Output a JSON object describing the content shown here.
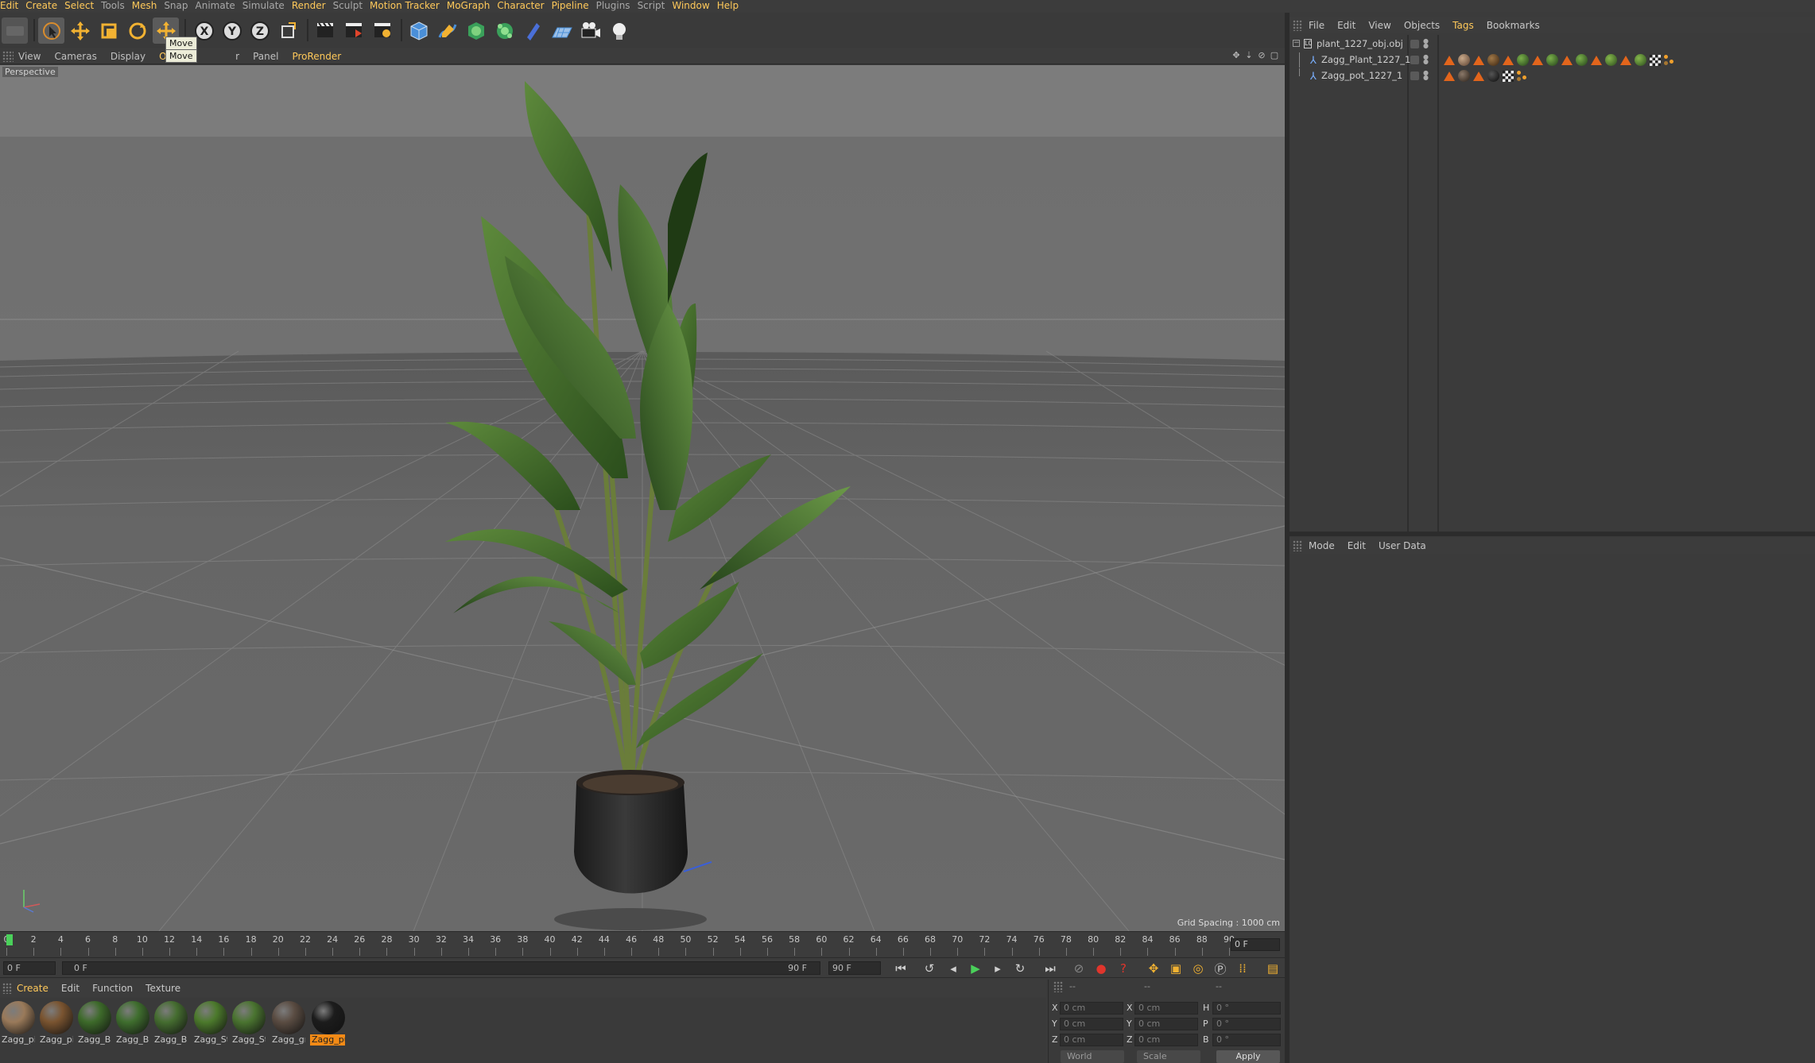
{
  "menu": {
    "items": [
      "Edit",
      "Create",
      "Select",
      "Tools",
      "Mesh",
      "Snap",
      "Animate",
      "Simulate",
      "Render",
      "Sculpt",
      "Motion Tracker",
      "MoGraph",
      "Character",
      "Pipeline",
      "Plugins",
      "Script",
      "Window",
      "Help"
    ]
  },
  "toolbar": {
    "tooltip": "Move",
    "tooltip_secondary": "Move",
    "axis_x": "X",
    "axis_y": "Y",
    "axis_z": "Z"
  },
  "viewport_menu": {
    "items": [
      "View",
      "Cameras",
      "Display",
      "Option",
      "r",
      "Panel",
      "ProRender"
    ]
  },
  "viewport": {
    "label": "Perspective",
    "grid_spacing": "Grid Spacing : 1000 cm"
  },
  "timeline": {
    "ticks": [
      "0",
      "2",
      "4",
      "6",
      "8",
      "10",
      "12",
      "14",
      "16",
      "18",
      "20",
      "22",
      "24",
      "26",
      "28",
      "30",
      "32",
      "34",
      "36",
      "38",
      "40",
      "42",
      "44",
      "46",
      "48",
      "50",
      "52",
      "54",
      "56",
      "58",
      "60",
      "62",
      "64",
      "66",
      "68",
      "70",
      "72",
      "74",
      "76",
      "78",
      "80",
      "82",
      "84",
      "86",
      "88",
      "90"
    ],
    "current_frame": "0 F"
  },
  "transport": {
    "start_frame": "0 F",
    "range_start": "0 F",
    "range_end": "90 F",
    "end_frame": "90 F"
  },
  "material_menu": {
    "items": [
      "Create",
      "Edit",
      "Function",
      "Texture"
    ]
  },
  "materials": [
    {
      "label": "Zagg_pi",
      "color": "#9a7a5a"
    },
    {
      "label": "Zagg_pi",
      "color": "#7a5430"
    },
    {
      "label": "Zagg_Ba",
      "color": "#3d6a2a"
    },
    {
      "label": "Zagg_Bi",
      "color": "#3f6e2e"
    },
    {
      "label": "Zagg_Bi",
      "color": "#456d30"
    },
    {
      "label": "Zagg_St",
      "color": "#4c7a2c"
    },
    {
      "label": "Zagg_St",
      "color": "#4a7430"
    },
    {
      "label": "Zagg_gr",
      "color": "#5a4c42"
    },
    {
      "label": "Zagg_pu",
      "color": "#1c1c1c"
    }
  ],
  "coordinates": {
    "header": [
      "--",
      "--",
      "--"
    ],
    "rows": [
      {
        "l1": "X",
        "v1": "0 cm",
        "l2": "X",
        "v2": "0 cm",
        "l3": "H",
        "v3": "0 °"
      },
      {
        "l1": "Y",
        "v1": "0 cm",
        "l2": "Y",
        "v2": "0 cm",
        "l3": "P",
        "v3": "0 °"
      },
      {
        "l1": "Z",
        "v1": "0 cm",
        "l2": "Z",
        "v2": "0 cm",
        "l3": "B",
        "v3": "0 °"
      }
    ],
    "world": "World",
    "scale": "Scale",
    "apply": "Apply"
  },
  "object_manager": {
    "menu": [
      "File",
      "Edit",
      "View",
      "Objects",
      "Tags",
      "Bookmarks"
    ],
    "objects": [
      {
        "name": "plant_1227_obj.obj"
      },
      {
        "name": "Zagg_Plant_1227_1"
      },
      {
        "name": "Zagg_pot_1227_1"
      }
    ]
  },
  "attribute_manager": {
    "menu": [
      "Mode",
      "Edit",
      "User Data"
    ]
  },
  "colors": {
    "accent": "#ffc95a",
    "selection": "#f28a16",
    "play_green": "#4ad05a"
  }
}
